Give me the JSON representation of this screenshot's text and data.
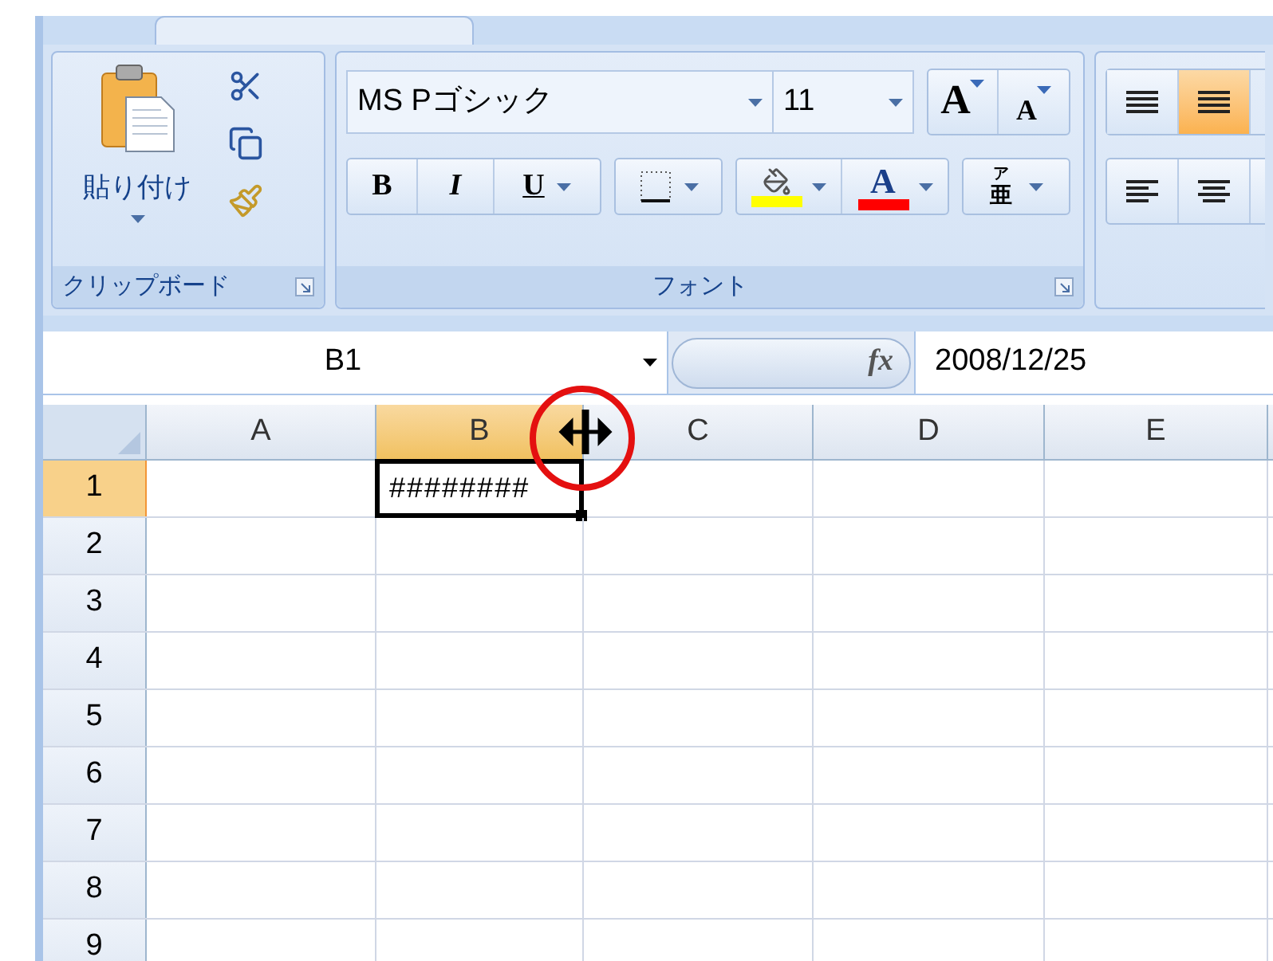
{
  "ribbon": {
    "clipboard": {
      "paste_label": "貼り付け",
      "group_label": "クリップボード"
    },
    "font": {
      "font_name": "MS Pゴシック",
      "font_size": "11",
      "grow_label": "A",
      "shrink_label": "A",
      "bold_label": "B",
      "italic_label": "I",
      "underline_label": "U",
      "font_color_label": "A",
      "phonetic_top": "ア",
      "phonetic_bottom": "亜",
      "group_label": "フォント"
    },
    "alignment": {
      "vertical_align": [
        {
          "selected": false
        },
        {
          "selected": true
        }
      ]
    }
  },
  "name_box": "B1",
  "function_label": "fx",
  "formula": "2008/12/25",
  "columns": [
    {
      "label": "A",
      "selected": false
    },
    {
      "label": "B",
      "selected": true
    },
    {
      "label": "C",
      "selected": false
    },
    {
      "label": "D",
      "selected": false
    },
    {
      "label": "E",
      "selected": false
    }
  ],
  "rows": [
    {
      "label": "1",
      "selected": true
    },
    {
      "label": "2",
      "selected": false
    },
    {
      "label": "3",
      "selected": false
    },
    {
      "label": "4",
      "selected": false
    },
    {
      "label": "5",
      "selected": false
    },
    {
      "label": "6",
      "selected": false
    },
    {
      "label": "7",
      "selected": false
    },
    {
      "label": "8",
      "selected": false
    },
    {
      "label": "9",
      "selected": false
    }
  ],
  "selected_cell": {
    "value": "########"
  }
}
